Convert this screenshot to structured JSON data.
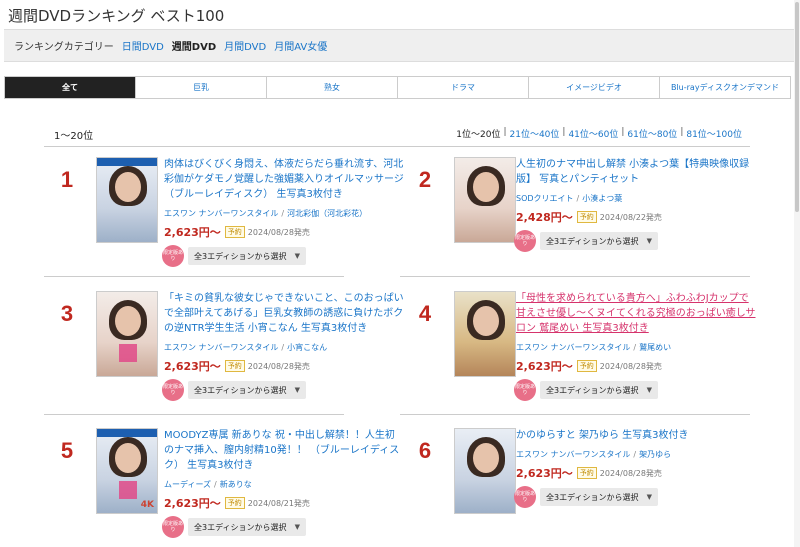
{
  "page": {
    "title": "週間DVDランキング ベスト100"
  },
  "categories": {
    "label": "ランキングカテゴリー",
    "items": [
      {
        "label": "日間DVD",
        "current": false
      },
      {
        "label": "週間DVD",
        "current": true
      },
      {
        "label": "月間DVD",
        "current": false
      },
      {
        "label": "月間AV女優",
        "current": false
      }
    ]
  },
  "tabs": [
    {
      "label": "全て",
      "active": true
    },
    {
      "label": "巨乳",
      "active": false
    },
    {
      "label": "熟女",
      "active": false
    },
    {
      "label": "ドラマ",
      "active": false
    },
    {
      "label": "イメージビデオ",
      "active": false
    },
    {
      "label": "Blu-rayディスクオンデマンド",
      "active": false
    }
  ],
  "range": {
    "current_label": "1〜20位",
    "nav": [
      {
        "label": "1位〜20位",
        "current": true
      },
      {
        "label": "21位〜40位",
        "current": false
      },
      {
        "label": "41位〜60位",
        "current": false
      },
      {
        "label": "61位〜80位",
        "current": false
      },
      {
        "label": "81位〜100位",
        "current": false
      }
    ],
    "separator": "|"
  },
  "products": [
    {
      "rank": "1",
      "title": "肉体はびくびく身悶え、体液だらだら垂れ流す、河北彩伽がケダモノ覚醒した強媚薬入りオイルマッサージ （ブルーレイディスク） 生写真3枚付き",
      "maker": "エスワン ナンバーワンスタイル",
      "actress": "河北彩伽（河北彩花）",
      "price": "2,623円〜",
      "preorder": "予約",
      "date": "2024/08/28発売",
      "badge": "限定版あり",
      "edition": "全3エディションから選択"
    },
    {
      "rank": "2",
      "title": "人生初のナマ中出し解禁 小湊よつ葉【特典映像収録版】 写真とパンティセット",
      "maker": "SODクリエイト",
      "actress": "小湊よつ葉",
      "price": "2,428円〜",
      "preorder": "予約",
      "date": "2024/08/22発売",
      "badge": "限定版あり",
      "edition": "全3エディションから選択"
    },
    {
      "rank": "3",
      "title": "「キミの貧乳な彼女じゃできないこと、このおっぱいで全部叶えてあげる」巨乳女教師の誘惑に負けたボクの逆NTR学生生活 小宵こなん 生写真3枚付き",
      "maker": "エスワン ナンバーワンスタイル",
      "actress": "小宵こなん",
      "price": "2,623円〜",
      "preorder": "予約",
      "date": "2024/08/28発売",
      "badge": "限定版あり",
      "edition": "全3エディションから選択"
    },
    {
      "rank": "4",
      "title": "「母性を求められている貴方へ」ふわふわJカップで甘えさせ優し〜くヌイてくれる究極のおっぱい癒しサロン 鷲尾めい 生写真3枚付き",
      "maker": "エスワン ナンバーワンスタイル",
      "actress": "鷲尾めい",
      "price": "2,623円〜",
      "preorder": "予約",
      "date": "2024/08/28発売",
      "badge": "限定版あり",
      "edition": "全3エディションから選択"
    },
    {
      "rank": "5",
      "title": "MOODYZ専属 新ありな 祝・中出し解禁！！人生初のナマ挿入、膣内射精10発！！ （ブルーレイディスク） 生写真3枚付き",
      "maker": "ムーディーズ",
      "actress": "新ありな",
      "price": "2,623円〜",
      "preorder": "予約",
      "date": "2024/08/21発売",
      "badge": "限定版あり",
      "edition": "全3エディションから選択"
    },
    {
      "rank": "6",
      "title": "かのゆらすと 架乃ゆら 生写真3枚付き",
      "maker": "エスワン ナンバーワンスタイル",
      "actress": "架乃ゆら",
      "price": "2,623円〜",
      "preorder": "予約",
      "date": "2024/08/28発売",
      "badge": "限定版あり",
      "edition": "全3エディションから選択"
    }
  ],
  "cover_hd_mark": "4K"
}
